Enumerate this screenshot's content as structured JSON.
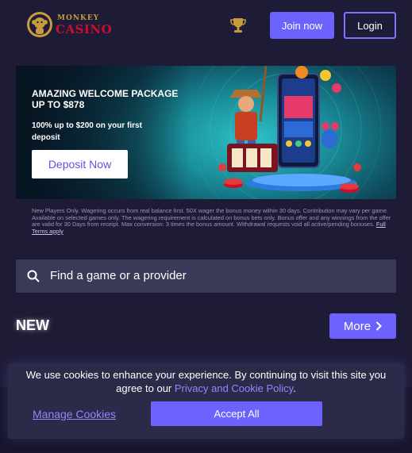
{
  "header": {
    "logo_top": "MONKEY",
    "logo_bottom": "CASINO",
    "join_label": "Join now",
    "login_label": "Login"
  },
  "banner": {
    "title": "AMAZING WELCOME PACKAGE UP TO $878",
    "subtitle": "100% up to $200 on your first deposit",
    "cta_label": "Deposit Now"
  },
  "terms": {
    "text": "New Players Only. Wagering occurs from real balance first. 50X wager the bonus money within 30 days. Contribution may vary per game. Available on selected games only. The wagering requirement is calculated on bonus bets only. Bonus offer and any winnings from the offer are valid for 30 Days from receipt. Max conversion: 3 times the bonus amount. Withdrawal requests void all active/pending bonuses.",
    "link_label": "Full Terms apply"
  },
  "search": {
    "placeholder": "Find a game or a provider"
  },
  "section": {
    "title": "NEW",
    "more_label": "More"
  },
  "cookie": {
    "text_before": "We use cookies to enhance your experience. By continuing to visit this site you agree to our",
    "link_label": "Privacy and Cookie Policy",
    "text_after": ".",
    "manage_label": "Manage Cookies",
    "accept_label": "Accept All"
  },
  "colors": {
    "background": "#1e1b36",
    "accent": "#6c63ff",
    "link": "#8f88ff",
    "search_bg": "#3a3a58",
    "cookie_bg": "#2c2a49"
  },
  "icons": [
    "monkey-logo-icon",
    "trophy-icon",
    "search-icon",
    "chevron-right-icon"
  ]
}
